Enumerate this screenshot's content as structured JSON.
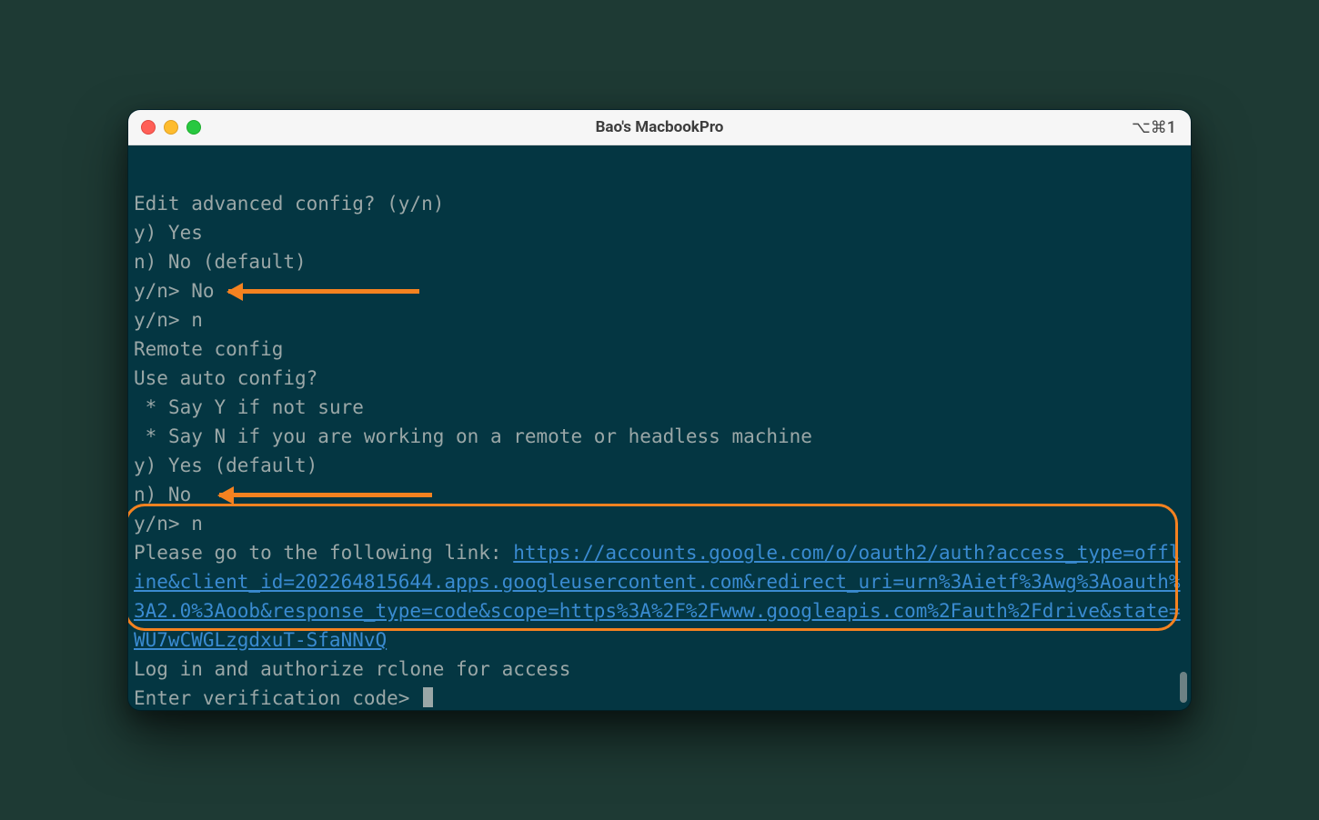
{
  "window": {
    "title": "Bao's MacbookPro",
    "shortcut": "⌥⌘1"
  },
  "terminal": {
    "lines": [
      "Edit advanced config? (y/n)",
      "y) Yes",
      "n) No (default)",
      "y/n> No",
      "y/n> n",
      "Remote config",
      "Use auto config?",
      " * Say Y if not sure",
      " * Say N if you are working on a remote or headless machine",
      "y) Yes (default)",
      "n) No",
      "y/n> n"
    ],
    "link_prefix": "Please go to the following link: ",
    "link_url": "https://accounts.google.com/o/oauth2/auth?access_type=offline&client_id=202264815644.apps.googleusercontent.com&redirect_uri=urn%3Aietf%3Awg%3Aoauth%3A2.0%3Aoob&response_type=code&scope=https%3A%2F%2Fwww.googleapis.com%2Fauth%2Fdrive&state=WU7wCWGLzgdxuT-SfaNNvQ",
    "after_link": "Log in and authorize rclone for access",
    "prompt": "Enter verification code> "
  },
  "annotations": {
    "arrows": [
      "annotation-arrow-1",
      "annotation-arrow-2"
    ],
    "highlight": "oauth-url-highlight"
  }
}
